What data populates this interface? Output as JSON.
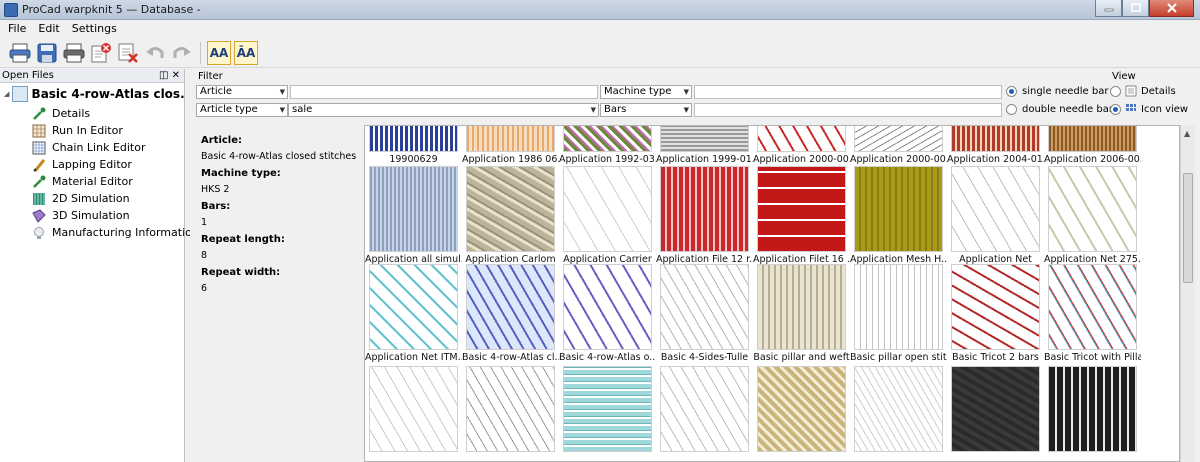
{
  "window": {
    "title": "ProCad warpknit 5 — Database -"
  },
  "menu": [
    "File",
    "Edit",
    "Settings"
  ],
  "toolbar": {
    "icons": [
      "print-icon",
      "save-icon",
      "print-preview-icon",
      "edit-pattern-icon",
      "delete-pattern-icon",
      "undo-icon",
      "redo-icon",
      "font-size-a-icon",
      "font-size-aa-icon"
    ],
    "font_a": "AA",
    "font_b": "ĀA"
  },
  "open_files": {
    "header": "Open Files",
    "root": "Basic 4-row-Atlas clos...",
    "items": [
      "Details",
      "Run In Editor",
      "Chain Link Editor",
      "Lapping Editor",
      "Material Editor",
      "2D Simulation",
      "3D Simulation",
      "Manufacturing Information"
    ]
  },
  "filter": {
    "title": "Filter",
    "combo1": "Article",
    "combo2": "Article type",
    "combo2_value": "sale",
    "combo3": "Machine type",
    "combo4": "Bars",
    "single_needle": "single needle bar",
    "double_needle": "double needle bar"
  },
  "view": {
    "title": "View",
    "details": "Details",
    "icon_view": "Icon view"
  },
  "details": {
    "article_label": "Article:",
    "article_value": "Basic 4-row-Atlas closed stitches",
    "machine_label": "Machine type:",
    "machine_value": "HKS 2",
    "bars_label": "Bars:",
    "bars_value": "1",
    "repeat_length_label": "Repeat length:",
    "repeat_length_value": "8",
    "repeat_width_label": "Repeat width:",
    "repeat_width_value": "6"
  },
  "gallery": {
    "rows": [
      [
        "19900629",
        "Application 1986 06...",
        "Application 1992-03...",
        "Application 1999-01...",
        "Application 2000-00...",
        "Application 2000-00...",
        "Application 2004-01...",
        "Application 2006-00..."
      ],
      [
        "Application all simul...",
        "Application Carlom",
        "Application Carrier",
        "Application File 12 r...",
        "Application Filet 16 ...",
        "Application Mesh H...",
        "Application Net",
        "Application Net 275..."
      ],
      [
        "Application Net ITM...",
        "Basic 4-row-Atlas cl...",
        "Basic 4-row-Atlas o...",
        "Basic 4-Sides-Tulle",
        "Basic pillar and weft",
        "Basic pillar open stit...",
        "Basic Tricot 2 bars",
        "Basic Tricot with Pillar"
      ],
      [
        "",
        "",
        "",
        "",
        "",
        "",
        "",
        ""
      ]
    ]
  }
}
